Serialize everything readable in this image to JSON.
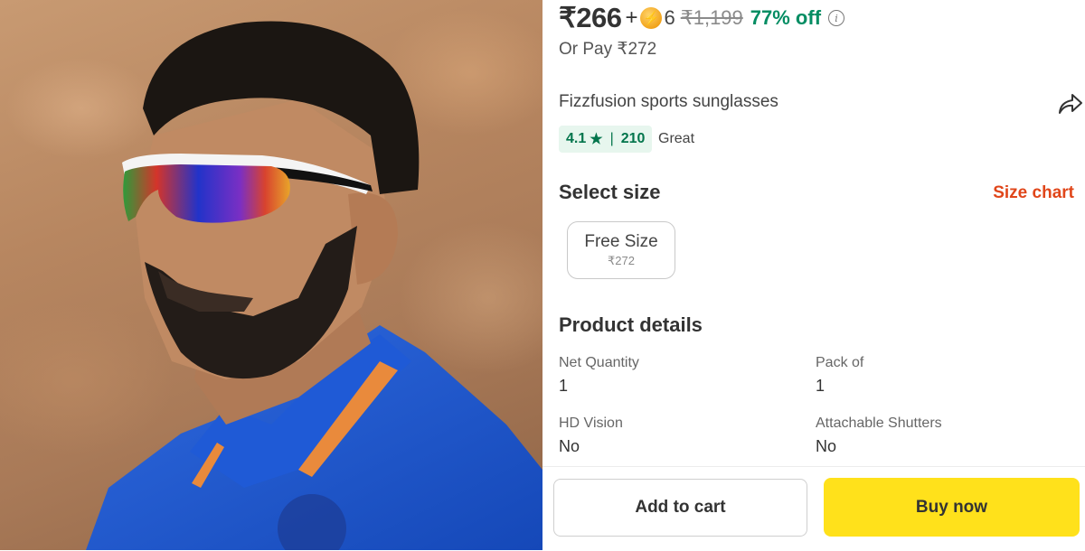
{
  "product_image": {
    "alt": "Model wearing sports sunglasses"
  },
  "pricing": {
    "price": "₹266",
    "plus": "+",
    "coin_icon": "lightning-coin-icon",
    "coin_glyph": "⚡",
    "coins": "6",
    "mrp": "₹1,199",
    "discount": "77% off",
    "info_icon": "info-icon",
    "or_pay": "Or Pay ₹272"
  },
  "product": {
    "title": "Fizzfusion sports sunglasses",
    "share_icon": "share-icon"
  },
  "rating": {
    "value": "4.1",
    "star": "★",
    "separator": "|",
    "count": "210",
    "label": "Great"
  },
  "size": {
    "heading": "Select size",
    "chart_link": "Size chart",
    "options": [
      {
        "label": "Free Size",
        "price": "₹272"
      }
    ]
  },
  "details": {
    "heading": "Product details",
    "specs": [
      {
        "key": "Net Quantity",
        "value": "1"
      },
      {
        "key": "Pack of",
        "value": "1"
      },
      {
        "key": "HD Vision",
        "value": "No"
      },
      {
        "key": "Attachable Shutters",
        "value": "No"
      }
    ]
  },
  "actions": {
    "add_to_cart": "Add to cart",
    "buy_now": "Buy now"
  },
  "colors": {
    "discount_green": "#038d63",
    "rating_bg": "#e7f6ee",
    "size_chart_orange": "#e0461a",
    "buy_yellow": "#ffe11b"
  }
}
